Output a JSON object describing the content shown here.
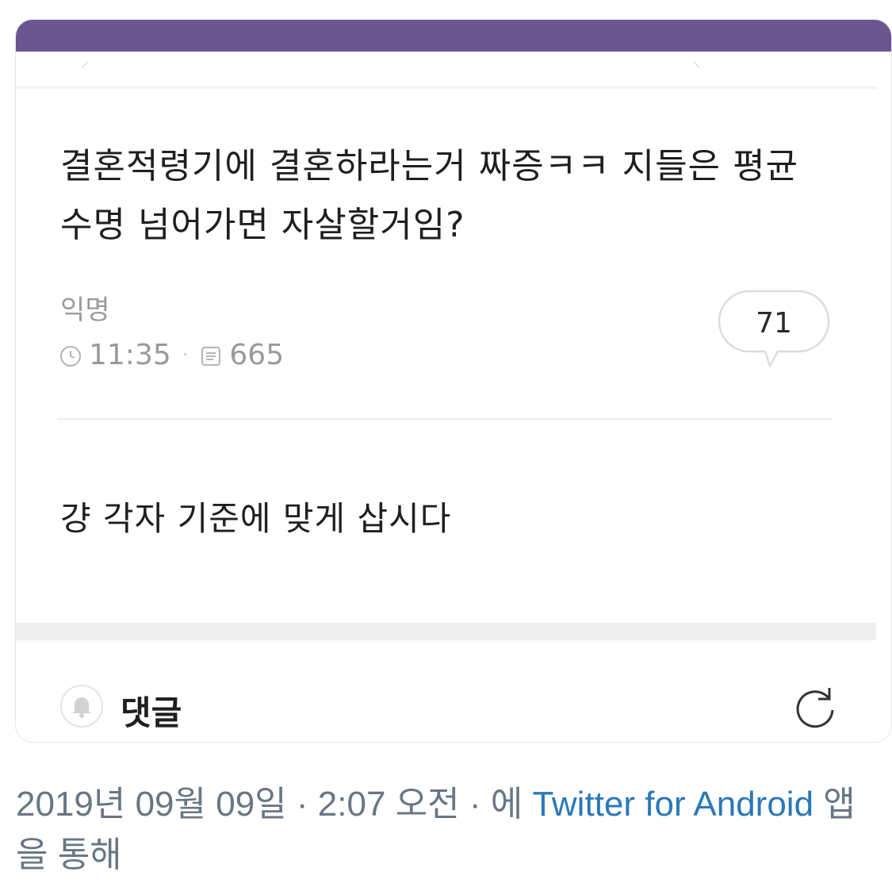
{
  "post": {
    "title": "결혼적령기에 결혼하라는거 짜증ㅋㅋ 지들은 평균수명 넘어가면 자살할거임?",
    "author": "익명",
    "time": "11:35",
    "views": "665",
    "comment_count": "71",
    "body": "걍 각자 기준에 맞게 삽시다"
  },
  "comments_bar": {
    "label": "댓글"
  },
  "tweet_footer": {
    "date": "2019년 09월 09일",
    "time": "2:07 오전",
    "via_prefix": "에",
    "source": "Twitter for Android",
    "via_suffix": "앱을 통해"
  },
  "colors": {
    "header_purple": "#6a558f",
    "tweet_meta_gray": "#687684",
    "link_blue": "#2a78b8"
  },
  "icons": [
    "clock-icon",
    "views-icon",
    "speech-bubble-icon",
    "bell-icon",
    "refresh-icon"
  ]
}
